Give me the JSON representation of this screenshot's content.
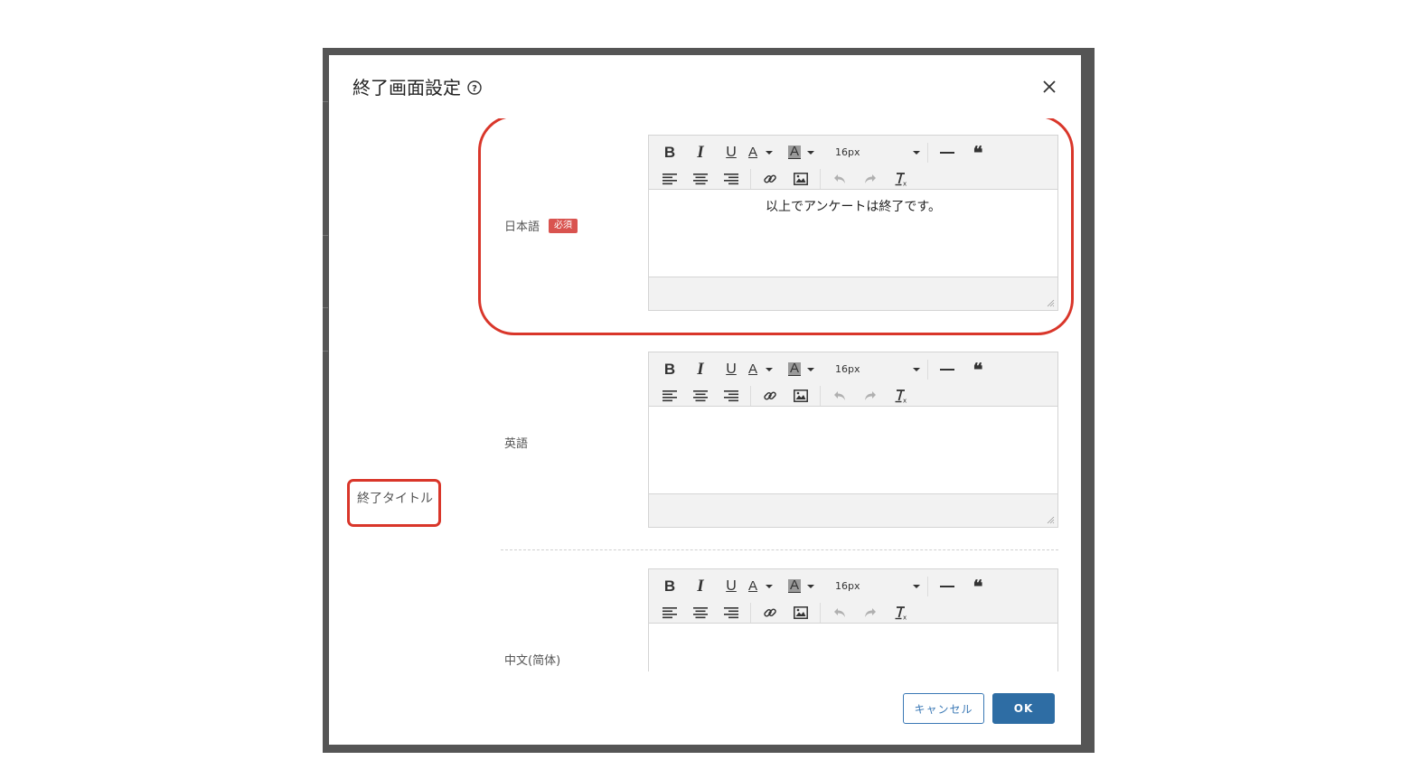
{
  "dialog": {
    "title": "終了画面設定",
    "help_icon": "question-circle-icon",
    "close_icon": "close-icon"
  },
  "field_group": {
    "label": "終了タイトル"
  },
  "toolbar": {
    "font_size": "16px",
    "icons": [
      "bold-icon",
      "italic-icon",
      "underline-icon",
      "text-color-icon",
      "background-color-icon",
      "font-size-select",
      "horizontal-rule-icon",
      "blockquote-icon",
      "align-left-icon",
      "align-center-icon",
      "align-right-icon",
      "link-icon",
      "image-icon",
      "undo-icon",
      "redo-icon",
      "clear-format-icon"
    ],
    "bold": "B",
    "italic": "I",
    "underline": "U",
    "color_letter": "A"
  },
  "languages": [
    {
      "label": "日本語",
      "required_badge": "必須",
      "content": "以上でアンケートは終了です。"
    },
    {
      "label": "英語",
      "content": ""
    },
    {
      "label": "中文(简体)",
      "content": ""
    }
  ],
  "footer": {
    "cancel_label": "キャンセル",
    "ok_label": "OK"
  },
  "colors": {
    "highlight": "#d9362a",
    "primary": "#2e6da4",
    "required": "#d9534f"
  }
}
